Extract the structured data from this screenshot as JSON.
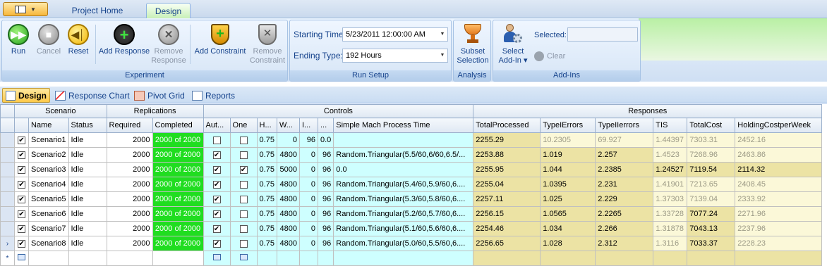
{
  "app": {
    "tabs": [
      "Project Home",
      "Design"
    ]
  },
  "ribbon": {
    "experiment": {
      "label": "Experiment",
      "run": "Run",
      "cancel": "Cancel",
      "reset": "Reset",
      "add_response": "Add Response",
      "remove_response_1": "Remove",
      "remove_response_2": "Response",
      "add_constraint": "Add Constraint",
      "remove_constraint_1": "Remove",
      "remove_constraint_2": "Constraint"
    },
    "run_setup": {
      "label": "Run Setup",
      "starting_time_label": "Starting Time:",
      "starting_time_value": "5/23/2011 12:00:00 AM",
      "ending_type_label": "Ending Type:",
      "ending_type_value": "192 Hours"
    },
    "analysis": {
      "label": "Analysis",
      "subset_1": "Subset",
      "subset_2": "Selection"
    },
    "add_ins": {
      "label": "Add-Ins",
      "select_1": "Select",
      "select_2": "Add-In ▾",
      "selected_label": "Selected:",
      "selected_value": "",
      "clear": "Clear"
    }
  },
  "doc_tabs": [
    "Design",
    "Response Chart",
    "Pivot Grid",
    "Reports"
  ],
  "grid": {
    "groups": [
      "Scenario",
      "Replications",
      "Controls",
      "Responses"
    ],
    "columns": [
      "Name",
      "Status",
      "Required",
      "Completed",
      "Aut...",
      "One",
      "H...",
      "W...",
      "I...",
      "...",
      "Simple Mach Process Time",
      "TotalProcessed",
      "TypeIErrors",
      "TypeIIerrors",
      "TIS",
      "TotalCost",
      "HoldingCostperWeek"
    ],
    "rows": [
      {
        "name": "Scenario1",
        "status": "Idle",
        "required": "2000",
        "completed": "2000 of 2000",
        "aut": false,
        "one": false,
        "h": "0.75",
        "w": "0",
        "i": "96",
        "x": "0.0",
        "proc": "",
        "tp": "2255.29",
        "t1": "10.2305",
        "t2": "69.927",
        "tis": "1.44397",
        "cost": "7303.31",
        "hold": "2452.16"
      },
      {
        "name": "Scenario2",
        "status": "Idle",
        "required": "2000",
        "completed": "2000 of 2000",
        "aut": true,
        "one": false,
        "h": "0.75",
        "w": "4800",
        "i": "0",
        "x": "96",
        "proc": "Random.Triangular(5.5/60,6/60,6.5/...",
        "tp": "2253.88",
        "t1": "1.019",
        "t2": "2.257",
        "tis": "1.4523",
        "cost": "7268.96",
        "hold": "2463.86"
      },
      {
        "name": "Scenario3",
        "status": "Idle",
        "required": "2000",
        "completed": "2000 of 2000",
        "aut": true,
        "one": true,
        "h": "0.75",
        "w": "5000",
        "i": "0",
        "x": "96",
        "proc": "0.0",
        "tp": "2255.95",
        "t1": "1.044",
        "t2": "2.2385",
        "tis": "1.24527",
        "cost": "7119.54",
        "hold": "2114.32"
      },
      {
        "name": "Scenario4",
        "status": "Idle",
        "required": "2000",
        "completed": "2000 of 2000",
        "aut": true,
        "one": false,
        "h": "0.75",
        "w": "4800",
        "i": "0",
        "x": "96",
        "proc": "Random.Triangular(5.4/60,5.9/60,6....",
        "tp": "2255.04",
        "t1": "1.0395",
        "t2": "2.231",
        "tis": "1.41901",
        "cost": "7213.65",
        "hold": "2408.45"
      },
      {
        "name": "Scenario5",
        "status": "Idle",
        "required": "2000",
        "completed": "2000 of 2000",
        "aut": true,
        "one": false,
        "h": "0.75",
        "w": "4800",
        "i": "0",
        "x": "96",
        "proc": "Random.Triangular(5.3/60,5.8/60,6....",
        "tp": "2257.11",
        "t1": "1.025",
        "t2": "2.229",
        "tis": "1.37303",
        "cost": "7139.04",
        "hold": "2333.92"
      },
      {
        "name": "Scenario6",
        "status": "Idle",
        "required": "2000",
        "completed": "2000 of 2000",
        "aut": true,
        "one": false,
        "h": "0.75",
        "w": "4800",
        "i": "0",
        "x": "96",
        "proc": "Random.Triangular(5.2/60,5.7/60,6....",
        "tp": "2256.15",
        "t1": "1.0565",
        "t2": "2.2265",
        "tis": "1.33728",
        "cost": "7077.24",
        "hold": "2271.96"
      },
      {
        "name": "Scenario7",
        "status": "Idle",
        "required": "2000",
        "completed": "2000 of 2000",
        "aut": true,
        "one": false,
        "h": "0.75",
        "w": "4800",
        "i": "0",
        "x": "96",
        "proc": "Random.Triangular(5.1/60,5.6/60,6....",
        "tp": "2254.46",
        "t1": "1.034",
        "t2": "2.266",
        "tis": "1.31878",
        "cost": "7043.13",
        "hold": "2237.96"
      },
      {
        "name": "Scenario8",
        "status": "Idle",
        "required": "2000",
        "completed": "2000 of 2000",
        "aut": true,
        "one": false,
        "h": "0.75",
        "w": "4800",
        "i": "0",
        "x": "96",
        "proc": "Random.Triangular(5.0/60,5.5/60,6....",
        "tp": "2256.65",
        "t1": "1.028",
        "t2": "2.312",
        "tis": "1.3116",
        "cost": "7033.37",
        "hold": "2228.23"
      }
    ],
    "row_markers": [
      "",
      "",
      "",
      "",
      "",
      "",
      "",
      "›",
      "*"
    ]
  }
}
